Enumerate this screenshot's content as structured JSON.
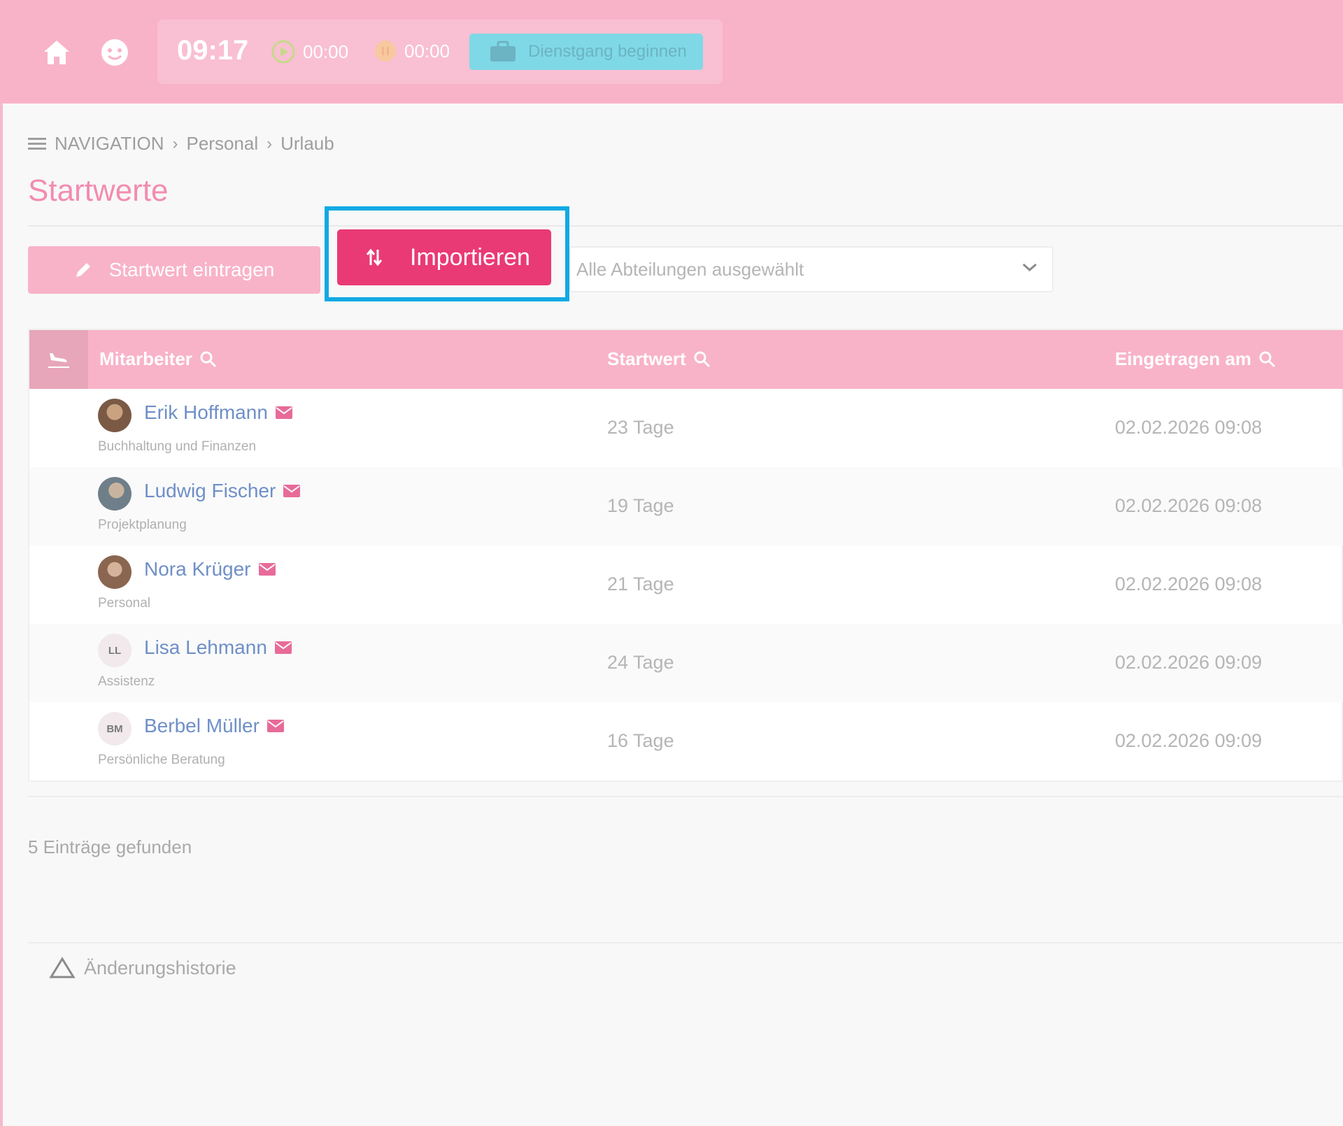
{
  "header": {
    "clock": "09:17",
    "timer_work": "00:00",
    "timer_break": "00:00",
    "duty_button": "Dienstgang beginnen"
  },
  "breadcrumb": {
    "nav": "NAVIGATION",
    "level1": "Personal",
    "level2": "Urlaub"
  },
  "page": {
    "title": "Startwerte"
  },
  "toolbar": {
    "entry_button": "Startwert eintragen",
    "import_button": "Importieren",
    "department_select": "Alle Abteilungen ausgewählt"
  },
  "table": {
    "columns": {
      "employee": "Mitarbeiter",
      "start_value": "Startwert",
      "entered_at": "Eingetragen am"
    },
    "rows": [
      {
        "name": "Erik Hoffmann",
        "department": "Buchhaltung und Finanzen",
        "start_value": "23 Tage",
        "entered_at": "02.02.2026 09:08",
        "initials": ""
      },
      {
        "name": "Ludwig Fischer",
        "department": "Projektplanung",
        "start_value": "19 Tage",
        "entered_at": "02.02.2026 09:08",
        "initials": ""
      },
      {
        "name": "Nora Krüger",
        "department": "Personal",
        "start_value": "21 Tage",
        "entered_at": "02.02.2026 09:08",
        "initials": ""
      },
      {
        "name": "Lisa Lehmann",
        "department": "Assistenz",
        "start_value": "24 Tage",
        "entered_at": "02.02.2026 09:09",
        "initials": "LL"
      },
      {
        "name": "Berbel Müller",
        "department": "Persönliche Beratung",
        "start_value": "16 Tage",
        "entered_at": "02.02.2026 09:09",
        "initials": "BM"
      }
    ]
  },
  "footer": {
    "count": "5 Einträge gefunden",
    "history": "Änderungshistorie"
  },
  "colors": {
    "header_bg": "#f8b3c9",
    "accent": "#e93a76",
    "highlight": "#11a9e3",
    "link": "#6f8fc7"
  }
}
